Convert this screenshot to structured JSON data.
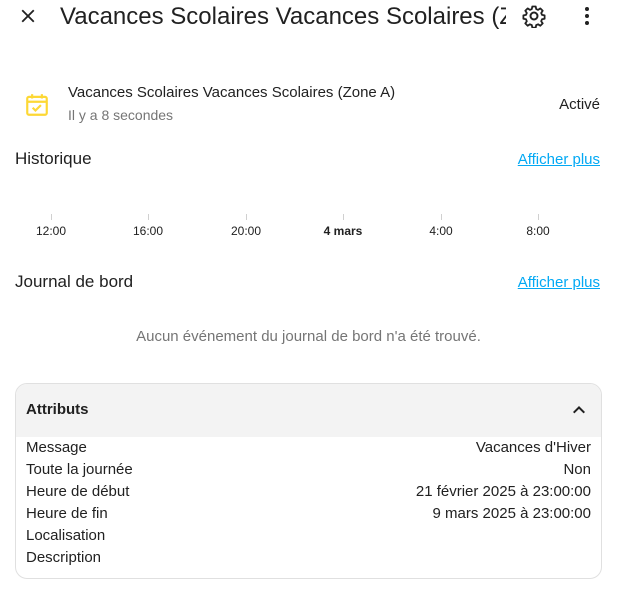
{
  "header": {
    "title": "Vacances Scolaires Vacances Scolaires (Zone A)",
    "close_icon": "close-icon",
    "settings_icon": "gear-icon",
    "more_icon": "more-vertical-icon"
  },
  "entity": {
    "icon": "calendar-check-icon",
    "icon_color": "#fdd835",
    "name": "Vacances Scolaires Vacances Scolaires (Zone A)",
    "last_changed": "Il y a 8 secondes",
    "state": "Activé"
  },
  "history": {
    "title": "Historique",
    "show_more": "Afficher plus",
    "ticks": [
      "12:00",
      "16:00",
      "20:00",
      "4 mars",
      "4:00",
      "8:00"
    ]
  },
  "logbook": {
    "title": "Journal de bord",
    "show_more": "Afficher plus",
    "empty_message": "Aucun événement du journal de bord n'a été trouvé."
  },
  "attributes": {
    "title": "Attributs",
    "rows": [
      {
        "key": "Message",
        "value": "Vacances d'Hiver"
      },
      {
        "key": "Toute la journée",
        "value": "Non"
      },
      {
        "key": "Heure de début",
        "value": "21 février 2025 à 23:00:00"
      },
      {
        "key": "Heure de fin",
        "value": "9 mars 2025 à 23:00:00"
      },
      {
        "key": "Localisation",
        "value": ""
      },
      {
        "key": "Description",
        "value": ""
      }
    ]
  },
  "colors": {
    "accent_link": "#03a9f4",
    "secondary_text": "#757575"
  }
}
